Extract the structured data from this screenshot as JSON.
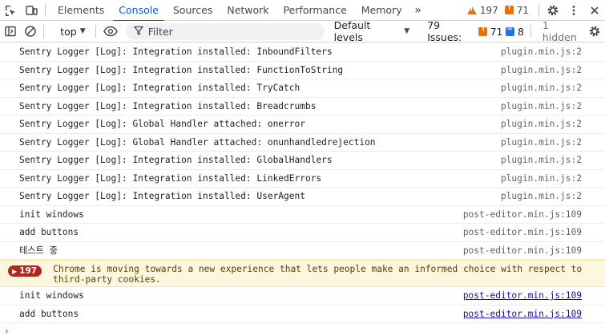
{
  "tabbar": {
    "tabs": [
      "Elements",
      "Console",
      "Sources",
      "Network",
      "Performance",
      "Memory"
    ],
    "active_tab": "Console",
    "more_tabs": "»",
    "warnings_count": "197",
    "issues_count": "71"
  },
  "toolbar": {
    "context": "top",
    "filter_placeholder": "Filter",
    "levels": "Default levels",
    "issues_label": "79 Issues:",
    "issues_warn": "71",
    "issues_info": "8",
    "hidden": "1 hidden"
  },
  "messages": [
    {
      "text": "Sentry Logger [Log]: Integration installed: InboundFilters",
      "source": "plugin.min.js:2"
    },
    {
      "text": "Sentry Logger [Log]: Integration installed: FunctionToString",
      "source": "plugin.min.js:2"
    },
    {
      "text": "Sentry Logger [Log]: Integration installed: TryCatch",
      "source": "plugin.min.js:2"
    },
    {
      "text": "Sentry Logger [Log]: Integration installed: Breadcrumbs",
      "source": "plugin.min.js:2"
    },
    {
      "text": "Sentry Logger [Log]: Global Handler attached: onerror",
      "source": "plugin.min.js:2"
    },
    {
      "text": "Sentry Logger [Log]: Global Handler attached: onunhandledrejection",
      "source": "plugin.min.js:2"
    },
    {
      "text": "Sentry Logger [Log]: Integration installed: GlobalHandlers",
      "source": "plugin.min.js:2"
    },
    {
      "text": "Sentry Logger [Log]: Integration installed: LinkedErrors",
      "source": "plugin.min.js:2"
    },
    {
      "text": "Sentry Logger [Log]: Integration installed: UserAgent",
      "source": "plugin.min.js:2"
    },
    {
      "text": "init windows",
      "source": "post-editor.min.js:109"
    },
    {
      "text": "add buttons",
      "source": "post-editor.min.js:109"
    },
    {
      "text": "테스트 중",
      "source": "post-editor.min.js:109"
    }
  ],
  "warning": {
    "count": "197",
    "text": "Chrome is moving towards a new experience that lets people make an informed choice with respect to third-party cookies."
  },
  "tail_messages": [
    {
      "text": "init windows",
      "source": "post-editor.min.js:109"
    },
    {
      "text": "add buttons",
      "source": "post-editor.min.js:109"
    }
  ],
  "prompt": "›",
  "colors": {
    "accent": "#0b57d0",
    "warning_bg": "#fef7e0",
    "badge": "#b3261e",
    "issue": "#e8710a"
  }
}
